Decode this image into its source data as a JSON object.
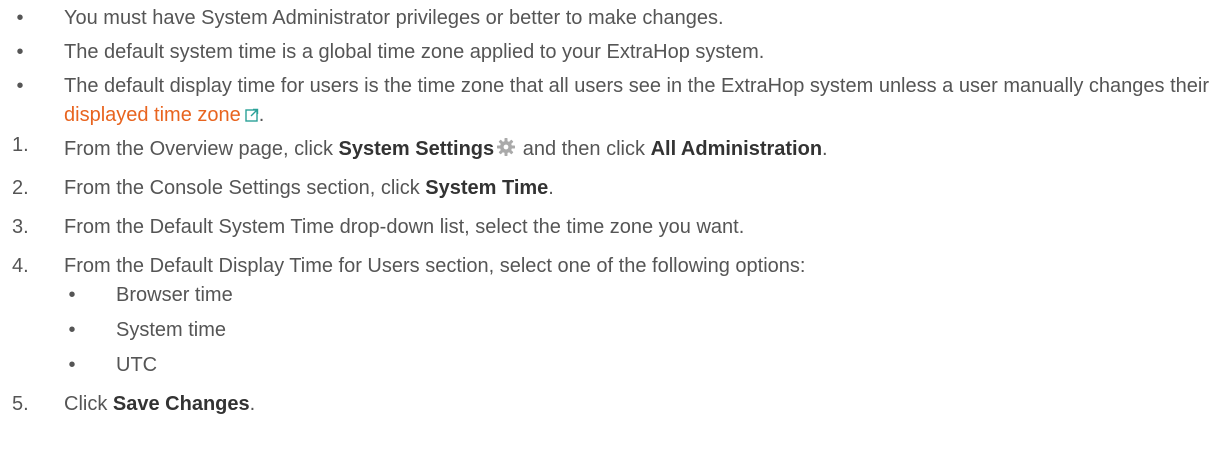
{
  "bullets": [
    {
      "text": "You must have System Administrator privileges or better to make changes."
    },
    {
      "text": "The default system time is a global time zone applied to your ExtraHop system."
    },
    {
      "text_before": "The default display time for users is the time zone that all users see in the ExtraHop system unless a user manually changes their ",
      "link_text": "displayed time zone",
      "text_after": "."
    }
  ],
  "steps": [
    {
      "num": "1.",
      "pre": "From the Overview page, click ",
      "bold1": "System Settings",
      "mid": " and then click ",
      "bold2": "All Administration",
      "post": "."
    },
    {
      "num": "2.",
      "pre": "From the Console Settings section, click ",
      "bold1": "System Time",
      "post": "."
    },
    {
      "num": "3.",
      "text": "From the Default System Time drop-down list, select the time zone you want."
    },
    {
      "num": "4.",
      "text": "From the Default Display Time for Users section, select one of the following options:",
      "options": [
        "Browser time",
        "System time",
        "UTC"
      ]
    },
    {
      "num": "5.",
      "pre": "Click ",
      "bold1": "Save Changes",
      "post": "."
    }
  ],
  "icons": {
    "gear": "gear-icon",
    "external_link": "external-link-icon"
  },
  "colors": {
    "text": "#555555",
    "link": "#e8641f",
    "icon": "#2aa198"
  }
}
